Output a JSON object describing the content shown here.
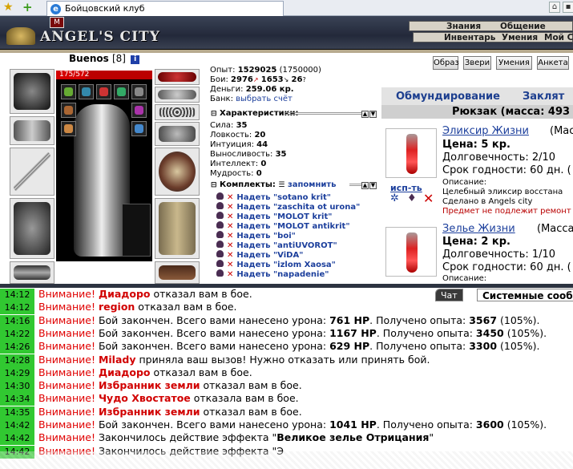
{
  "browser": {
    "tab_title": "Бойцовский клуб",
    "star_icon": "favorites-star-icon",
    "add_icon": "add-favorite-icon"
  },
  "site": {
    "logo_text": "ANGEL'S CITY",
    "flag_text": "M",
    "nav_top": [
      "Знания",
      "Общение"
    ],
    "nav_bottom": [
      "Инвентарь",
      "Умения",
      "Мой С"
    ]
  },
  "character": {
    "name": "Buenos",
    "level": "[8]",
    "hp_text": "175/572",
    "hp_fraction": 0.306,
    "info_badge": "i"
  },
  "stats": {
    "exp_label": "Опыт:",
    "exp_value": "1529025",
    "exp_next": "(1750000)",
    "fights_label": "Бои:",
    "wins": "2976",
    "losses": "1653",
    "draws": "26",
    "money_label": "Деньги:",
    "money_value": "259.06 кр.",
    "bank_label": "Банк:",
    "bank_link": "выбрать счёт"
  },
  "characteristics": {
    "header": "Характеристики:",
    "items": [
      {
        "label": "Сила:",
        "value": "35"
      },
      {
        "label": "Ловкость:",
        "value": "20"
      },
      {
        "label": "Интуиция:",
        "value": "44"
      },
      {
        "label": "Выносливость:",
        "value": "35"
      },
      {
        "label": "Интеллект:",
        "value": "0"
      },
      {
        "label": "Мудрость:",
        "value": "0"
      }
    ]
  },
  "sets": {
    "header": "Комплекты:",
    "remember_link": "запомнить",
    "items": [
      "Надеть \"sotano krit\"",
      "Надеть \"zaschita ot urona\"",
      "Надеть \"MOLOT krit\"",
      "Надеть \"MOLOT antikrit\"",
      "Надеть \"boi\"",
      "Надеть \"antiUVOROT\"",
      "Надеть \"ViDA\"",
      "Надеть \"izlom Xaosa\"",
      "Надеть \"napadenie\""
    ]
  },
  "buttons": [
    "Образ",
    "Звери",
    "Умения",
    "Анкета"
  ],
  "inventory": {
    "tabs": [
      "Обмундирование",
      "Заклят"
    ],
    "backpack_title": "Рюкзак (масса: 493",
    "use_label": "исп-ть",
    "items": [
      {
        "name": "Эликсир Жизни",
        "mass": "(Мас",
        "price": "Цена: 5 кр.",
        "durability": "Долговечность: 2/10",
        "expiry": "Срок годности: 60 дн. (",
        "desc_label": "Описание:",
        "desc": "Целебный эликсир восстана",
        "made": "Сделано в Angels city",
        "warning": "Предмет не подлежит ремонт"
      },
      {
        "name": "Зелье Жизни",
        "mass": "(Масса",
        "price": "Цена: 2 кр.",
        "durability": "Долговечность: 1/10",
        "expiry": "Срок годности: 60 дн. (",
        "desc_label": "Описание:"
      }
    ]
  },
  "chat": {
    "tabs": [
      "Чат",
      "Системные сообщ"
    ],
    "messages": [
      {
        "time": "14:12",
        "warn": "Внимание!",
        "nick": "Диадоро",
        "text": " отказал вам в бое."
      },
      {
        "time": "14:12",
        "warn": "Внимание!",
        "nick": "region",
        "text": " отказал вам в бое."
      },
      {
        "time": "14:16",
        "warn": "Внимание!",
        "pre": " Бой закончен. Всего вами нанесено урона: ",
        "dmg": "761 HP",
        "mid": ". Получено опыта: ",
        "exp": "3567",
        "post": " (105%)."
      },
      {
        "time": "14:22",
        "warn": "Внимание!",
        "pre": " Бой закончен. Всего вами нанесено урона: ",
        "dmg": "1167 HP",
        "mid": ". Получено опыта: ",
        "exp": "3450",
        "post": " (105%)."
      },
      {
        "time": "14:26",
        "warn": "Внимание!",
        "pre": " Бой закончен. Всего вами нанесено урона: ",
        "dmg": "629 HP",
        "mid": ". Получено опыта: ",
        "exp": "3300",
        "post": " (105%)."
      },
      {
        "time": "14:28",
        "warn": "Внимание!",
        "nick": "Milady",
        "text": " приняла ваш вызов! Нужно отказать или принять бой."
      },
      {
        "time": "14:29",
        "warn": "Внимание!",
        "nick": "Диадоро",
        "text": " отказал вам в бое."
      },
      {
        "time": "14:30",
        "warn": "Внимание!",
        "nick": "Избранник земли",
        "text": " отказал вам в бое."
      },
      {
        "time": "14:34",
        "warn": "Внимание!",
        "nick": "Чудо Хвостатое",
        "text": " отказала вам в бое."
      },
      {
        "time": "14:35",
        "warn": "Внимание!",
        "nick": "Избранник земли",
        "text": " отказал вам в бое."
      },
      {
        "time": "14:42",
        "warn": "Внимание!",
        "pre": " Бой закончен. Всего вами нанесено урона: ",
        "dmg": "1041 HP",
        "mid": ". Получено опыта: ",
        "exp": "3600",
        "post": " (105%)."
      },
      {
        "time": "14:42",
        "warn": "Внимание!",
        "pre": " Закончилось действие эффекта \"",
        "dmg": "Великое зелье Отрицания",
        "post": "\""
      },
      {
        "time": "14:42",
        "warn": "Внимание!",
        "pre": " Закончилось действие эффекта \"Э"
      }
    ]
  }
}
